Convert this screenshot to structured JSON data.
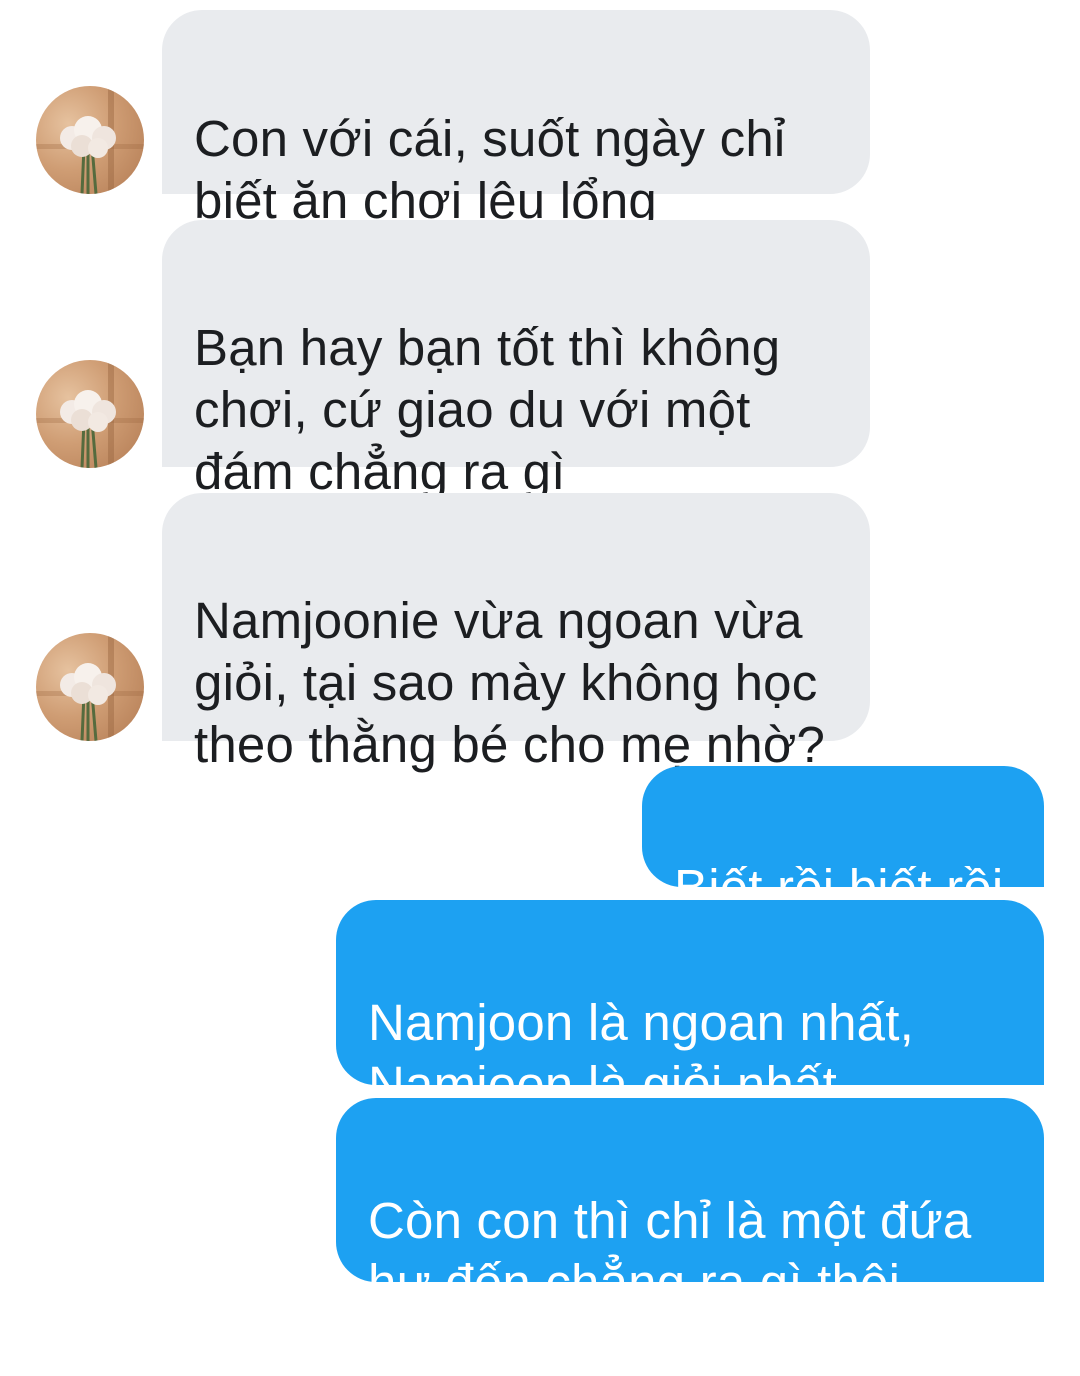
{
  "conversation": {
    "messages": [
      {
        "sender": "other",
        "text": "Con với cái, suốt ngày chỉ\nbiết ăn chơi lêu lổng"
      },
      {
        "sender": "other",
        "text": "Bạn hay bạn tốt thì không\nchơi, cứ giao du với một\nđám chẳng ra gì"
      },
      {
        "sender": "other",
        "text": "Namjoonie vừa ngoan vừa\ngiỏi, tại sao mày không học\ntheo thằng bé cho mẹ nhờ?"
      },
      {
        "sender": "me",
        "text": "Biết rồi biết rồi"
      },
      {
        "sender": "me",
        "text": "Namjoon là ngoan nhất,\nNamjoon là giỏi nhất"
      },
      {
        "sender": "me",
        "text": "Còn con thì chỉ là một đứa\như đốn chẳng ra gì thôi"
      }
    ]
  },
  "avatar": {
    "icon": "flower-bouquet-avatar",
    "colors": {
      "background": "#d4a37a",
      "shadow": "#9a6640",
      "petals": "#f3ebe6",
      "stems": "#556b3e"
    }
  },
  "colors": {
    "incoming_bubble": "#e9ebee",
    "incoming_text": "#1c1e21",
    "outgoing_bubble": "#1da1f2",
    "outgoing_text": "#ffffff",
    "background": "#ffffff"
  }
}
